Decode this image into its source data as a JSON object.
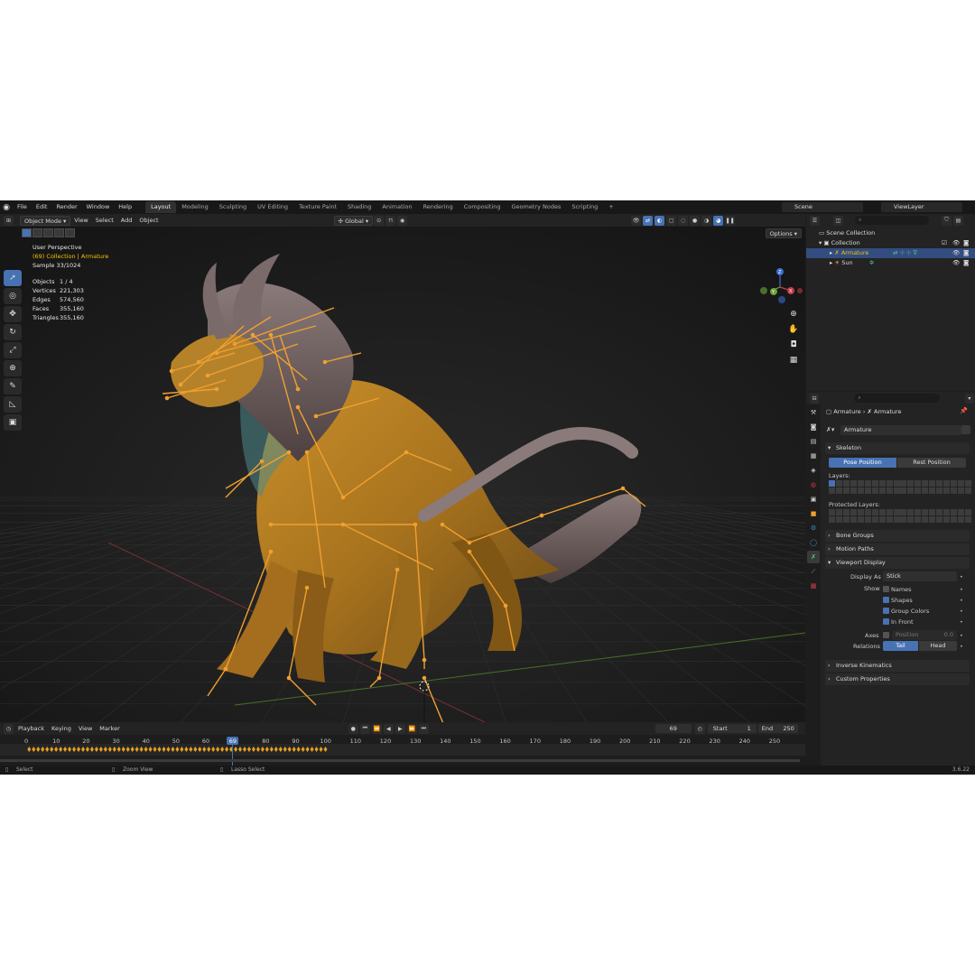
{
  "menu": {
    "items": [
      "File",
      "Edit",
      "Render",
      "Window",
      "Help"
    ],
    "workspaces": [
      "Layout",
      "Modeling",
      "Sculpting",
      "UV Editing",
      "Texture Paint",
      "Shading",
      "Animation",
      "Rendering",
      "Compositing",
      "Geometry Nodes",
      "Scripting"
    ],
    "active_workspace": "Layout",
    "add_tab": "+",
    "scene": "Scene",
    "view_layer": "ViewLayer"
  },
  "viewport_header": {
    "mode": "Object Mode",
    "menus": [
      "View",
      "Select",
      "Add",
      "Object"
    ],
    "transform_orientation": "Global",
    "options_label": "Options"
  },
  "overlay": {
    "view_name": "User Perspective",
    "collection_line": "(69) Collection | Armature",
    "sample": "Sample 33/1024",
    "stats": [
      {
        "label": "Objects",
        "value": "1 / 4"
      },
      {
        "label": "Vertices",
        "value": "221,303"
      },
      {
        "label": "Edges",
        "value": "574,560"
      },
      {
        "label": "Faces",
        "value": "355,160"
      },
      {
        "label": "Triangles",
        "value": "355,160"
      }
    ]
  },
  "gizmo": {
    "x": "X",
    "y": "Y",
    "z": "Z"
  },
  "timeline": {
    "menus": [
      "Playback",
      "Keying",
      "View",
      "Marker"
    ],
    "current_frame": "69",
    "start_label": "Start",
    "start": "1",
    "end_label": "End",
    "end": "250",
    "ticks": [
      "0",
      "10",
      "20",
      "30",
      "40",
      "50",
      "60",
      "69",
      "80",
      "90",
      "100",
      "110",
      "120",
      "130",
      "140",
      "150",
      "160",
      "170",
      "180",
      "190",
      "200",
      "210",
      "220",
      "230",
      "240",
      "250"
    ]
  },
  "status": {
    "select": "Select",
    "zoom": "Zoom View",
    "lasso": "Lasso Select",
    "version": "3.6.22"
  },
  "outliner": {
    "scene_collection": "Scene Collection",
    "collection": "Collection",
    "armature": "Armature",
    "sun": "Sun"
  },
  "properties": {
    "breadcrumb_object": "Armature",
    "breadcrumb_data": "Armature",
    "data_name": "Armature",
    "skeleton": {
      "title": "Skeleton",
      "pose_position": "Pose Position",
      "rest_position": "Rest Position",
      "layers_label": "Layers:",
      "protected_layers_label": "Protected Layers:"
    },
    "bone_groups": "Bone Groups",
    "motion_paths": "Motion Paths",
    "viewport_display": {
      "title": "Viewport Display",
      "display_as_label": "Display As",
      "display_as_value": "Stick",
      "show_label": "Show",
      "names": "Names",
      "shapes": "Shapes",
      "group_colors": "Group Colors",
      "in_front": "In Front",
      "axes_label": "Axes",
      "position_label": "Position",
      "position_value": "0.0",
      "relations_label": "Relations",
      "tail": "Tail",
      "head": "Head"
    },
    "inverse_kinematics": "Inverse Kinematics",
    "custom_properties": "Custom Properties"
  },
  "colors": {
    "accent": "#4772b3",
    "bone": "#f0a030",
    "highlight": "#f5c200"
  }
}
